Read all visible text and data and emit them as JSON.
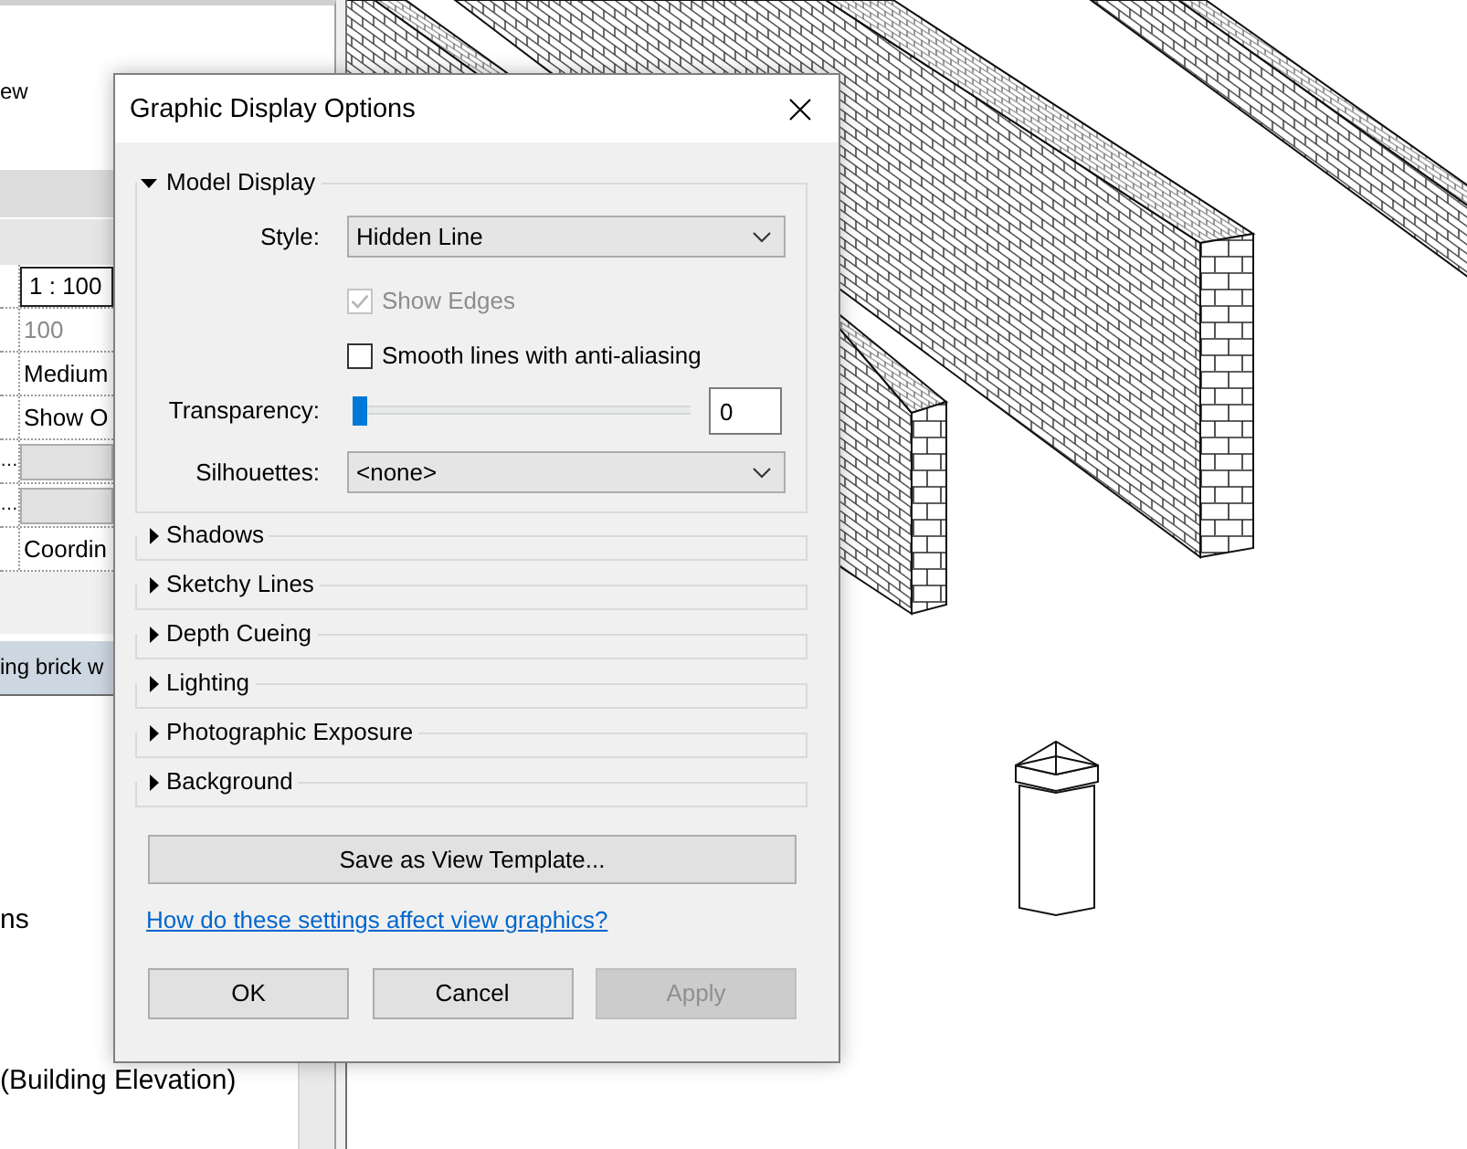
{
  "properties_panel": {
    "title": "ew",
    "rows": [
      {
        "kind": "input",
        "value": "1 : 100",
        "disabled": false
      },
      {
        "kind": "text",
        "value": "100",
        "disabled": true
      },
      {
        "kind": "text",
        "value": "Medium",
        "disabled": false
      },
      {
        "kind": "text",
        "value": "Show O",
        "disabled": false
      },
      {
        "kind": "button",
        "label": "…",
        "disabled": false
      },
      {
        "kind": "button",
        "label": "…",
        "disabled": false
      },
      {
        "kind": "text",
        "value": "Coordin",
        "disabled": false
      }
    ]
  },
  "project_browser": {
    "title": "ing brick w",
    "items": [
      {
        "label": "ns"
      },
      {
        "label": "(Building Elevation)"
      }
    ]
  },
  "dialog": {
    "title": "Graphic Display Options",
    "sections": [
      {
        "label": "Model Display",
        "expanded": true,
        "fields": [
          {
            "kind": "dropdown",
            "label": "Style:",
            "value": "Hidden Line"
          },
          {
            "kind": "checkbox",
            "label": "Show Edges",
            "checked": true,
            "disabled": true
          },
          {
            "kind": "checkbox",
            "label": "Smooth lines with anti-aliasing",
            "checked": false,
            "disabled": false
          },
          {
            "kind": "slider",
            "label": "Transparency:",
            "level": 0,
            "value": "0"
          },
          {
            "kind": "dropdown",
            "label": "Silhouettes:",
            "value": "<none>"
          }
        ]
      },
      {
        "label": "Shadows",
        "expanded": false
      },
      {
        "label": "Sketchy Lines",
        "expanded": false
      },
      {
        "label": "Depth Cueing",
        "expanded": false
      },
      {
        "label": "Lighting",
        "expanded": false
      },
      {
        "label": "Photographic Exposure",
        "expanded": false
      },
      {
        "label": "Background",
        "expanded": false
      }
    ],
    "template_button": "Save as View Template...",
    "help_link": "How do these settings affect view graphics?",
    "buttons": [
      {
        "label": "OK",
        "disabled": false
      },
      {
        "label": "Cancel",
        "disabled": false
      },
      {
        "label": "Apply",
        "disabled": true
      }
    ]
  }
}
